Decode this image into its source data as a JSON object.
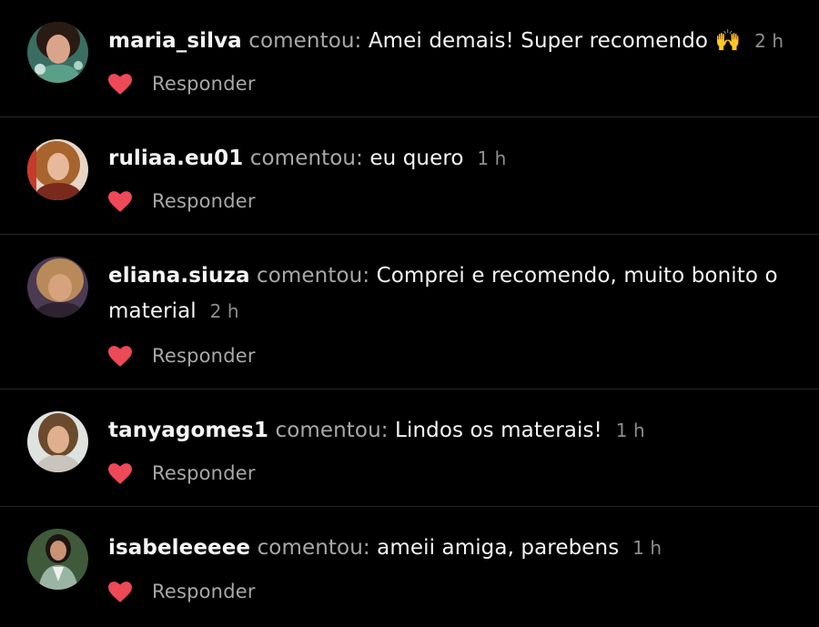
{
  "colors": {
    "background": "#000000",
    "heart": "#ed4956",
    "divider": "#262626"
  },
  "comments": [
    {
      "username": "maria_silva",
      "verb": "comentou:",
      "text": "Amei demais! Super recomendo 🙌",
      "time": "2 h",
      "reply_label": "Responder",
      "like_icon": "heart-icon"
    },
    {
      "username": "ruliaa.eu01",
      "verb": "comentou:",
      "text": "eu quero",
      "time": "1 h",
      "reply_label": "Responder",
      "like_icon": "heart-icon"
    },
    {
      "username": "eliana.siuza",
      "verb": "comentou:",
      "text": "Comprei e recomendo, muito bonito o material",
      "time": "2 h",
      "reply_label": "Responder",
      "like_icon": "heart-icon"
    },
    {
      "username": "tanyagomes1",
      "verb": "comentou:",
      "text": "Lindos os materais!",
      "time": "1 h",
      "reply_label": "Responder",
      "like_icon": "heart-icon"
    },
    {
      "username": "isabeleeeee",
      "verb": "comentou:",
      "text": "ameii amiga, parebens",
      "time": "1 h",
      "reply_label": "Responder",
      "like_icon": "heart-icon"
    }
  ]
}
